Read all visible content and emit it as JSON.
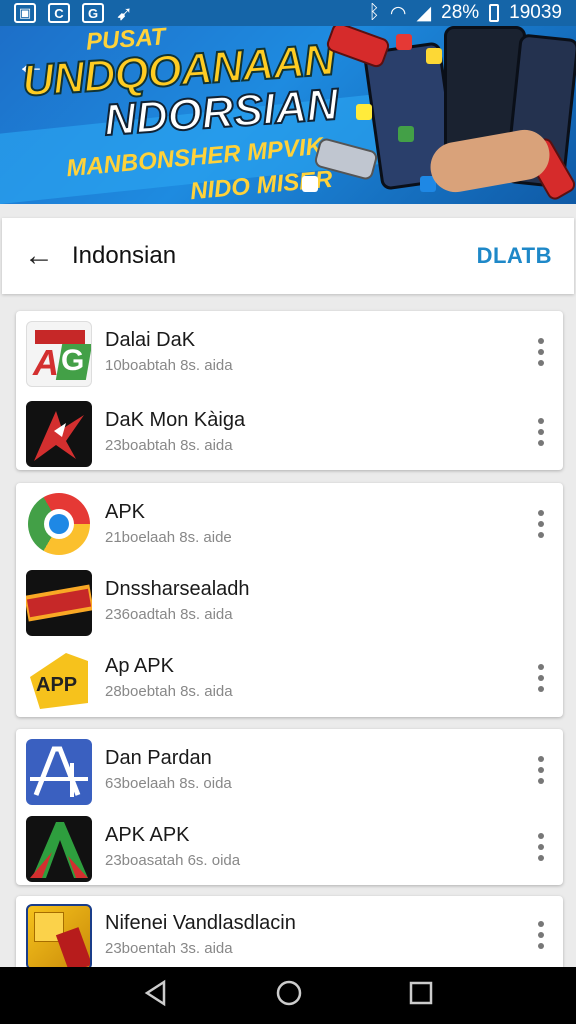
{
  "status_bar": {
    "left_icons": [
      "image-icon",
      "c-app-icon",
      "c-app-icon",
      "bird-icon"
    ],
    "battery": "28%",
    "time": "19039"
  },
  "banner": {
    "line1": "PUSAT",
    "line2": "UNDQOANAAN",
    "line3": "NDORSIAN",
    "line4": "MANBONSHER MPVIK",
    "line5": "NIDO MISER"
  },
  "header": {
    "title": "Indonsian",
    "action": "DLATB"
  },
  "groups": [
    {
      "items": [
        {
          "name": "Dalai DaK",
          "sub": "10boabtah 8s. aida",
          "icon": "ag-logo-icon"
        },
        {
          "name": "DaK Mon Kàiga",
          "sub": "23boabtah 8s. aida",
          "icon": "red-bird-logo-icon"
        }
      ]
    },
    {
      "items": [
        {
          "name": "APK",
          "sub": "21boelaah 8s. aide",
          "icon": "chrome-logo-icon"
        },
        {
          "name": "Dnssharsealadh",
          "sub": "236oadtah 8s. aida",
          "icon": "banner-badge-icon"
        },
        {
          "name": "Ap APK",
          "sub": "28boebtah 8s. aida",
          "icon": "apk-tag-icon"
        }
      ]
    },
    {
      "items": [
        {
          "name": "Dan Pardan",
          "sub": "63boelaah 8s. oida",
          "icon": "a-plus-logo-icon"
        },
        {
          "name": "APK APK",
          "sub": "23boasatah 6s. oida",
          "icon": "green-a-logo-icon"
        }
      ]
    },
    {
      "items": [
        {
          "name": "Nifenei Vandlasdlacin",
          "sub": "23boentah 3s. aida",
          "icon": "gold-box-icon"
        }
      ]
    }
  ],
  "nav": {
    "back": "back-icon",
    "home": "home-icon",
    "recents": "recents-icon"
  }
}
